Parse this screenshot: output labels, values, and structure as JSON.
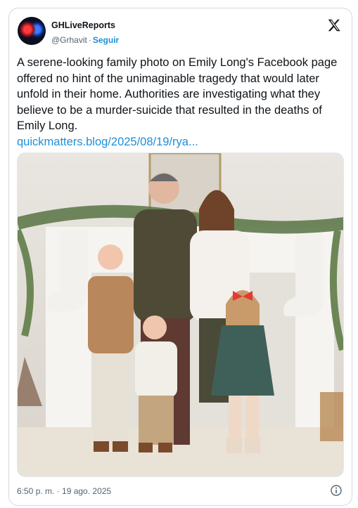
{
  "tweet": {
    "display_name": "GHLiveReports",
    "handle": "@Grhavit",
    "separator": "·",
    "follow_label": "Seguir",
    "body_text": "A serene-looking family photo on Emily Long's Facebook page offered no hint of the unimaginable tragedy that would later unfold in their home. Authorities are investigating what they believe to be a murder-suicide that resulted in the deaths of Emily Long.",
    "link_text": "quickmatters.blog/2025/08/19/rya...",
    "timestamp": "6:50 p. m. · 19 ago. 2025"
  },
  "icons": {
    "platform_logo": "x-logo-icon",
    "info": "info-icon"
  },
  "colors": {
    "link": "#1d8fd8",
    "text": "#0f1419",
    "muted": "#536471",
    "border": "#cfd9de"
  }
}
